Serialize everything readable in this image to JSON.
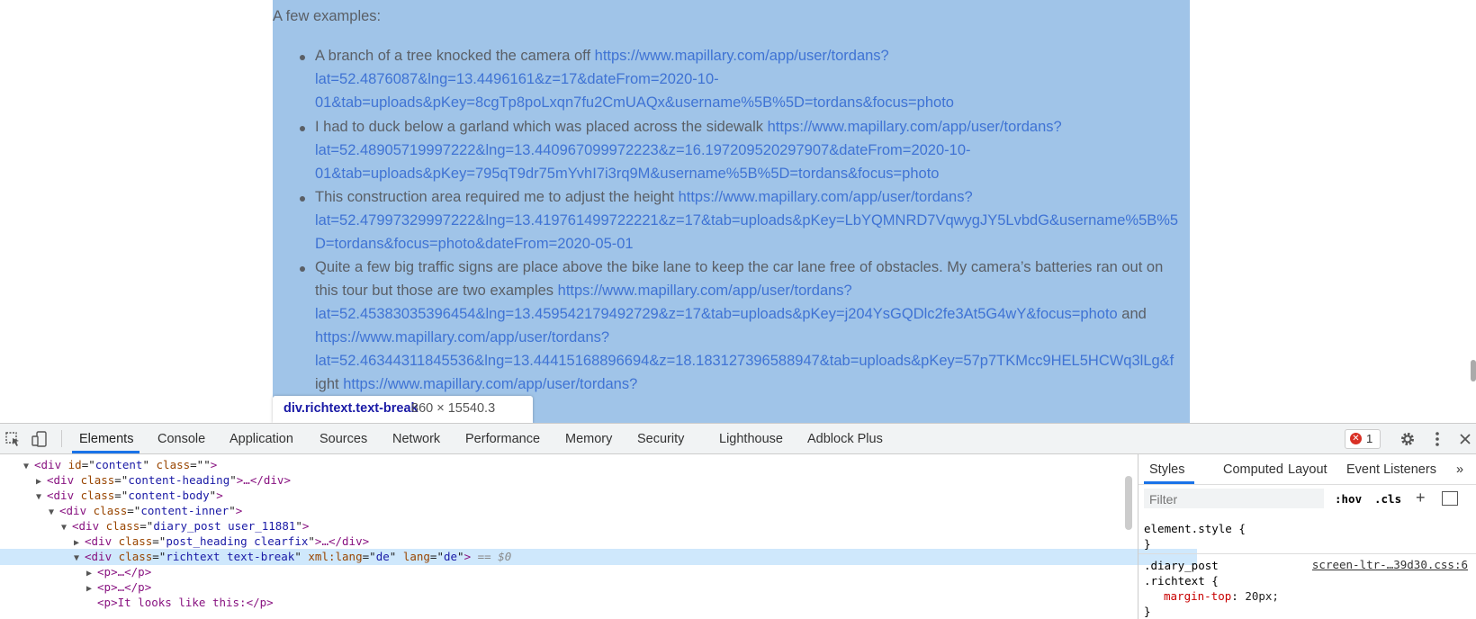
{
  "page": {
    "intro": "A few examples:",
    "bullets": [
      {
        "lines": [
          {
            "text": "A branch of a tree knocked the camera off ",
            "link": "https://www.mapillary.com/app/user/tordans?"
          },
          {
            "link": "lat=52.4876087&lng=13.4496161&z=17&dateFrom=2020-10-"
          },
          {
            "link": "01&tab=uploads&pKey=8cgTp8poLxqn7fu2CmUAQx&username%5B%5D=tordans&focus=photo"
          }
        ]
      },
      {
        "lines": [
          {
            "text": "I had to duck below a garland which was placed across the sidewalk ",
            "link": "https://www.mapillary.com/app/user/tordans?"
          },
          {
            "link": "lat=52.48905719997222&lng=13.440967099972223&z=16.197209520297907&dateFrom=2020-10-"
          },
          {
            "link": "01&tab=uploads&pKey=795qT9dr75mYvhI7i3rq9M&username%5B%5D=tordans&focus=photo"
          }
        ]
      },
      {
        "lines": [
          {
            "text": "This construction area required me to adjust the height ",
            "link": "https://www.mapillary.com/app/user/tordans?"
          },
          {
            "link": "lat=52.47997329997222&lng=13.419761499722221&z=17&tab=uploads&pKey=LbYQMNRD7VqwygJY5LvbdG&username%5B%5"
          },
          {
            "link": "D=tordans&focus=photo&dateFrom=2020-05-01"
          }
        ]
      },
      {
        "lines": [
          {
            "text": "Quite a few big traffic signs are place above the bike lane to keep the car lane free of obstacles. My camera’s batteries ran out on"
          },
          {
            "text": "this tour but those are two examples ",
            "link": "https://www.mapillary.com/app/user/tordans?"
          },
          {
            "link": "lat=52.45383035396454&lng=13.459542179492729&z=17&tab=uploads&pKey=j204YsGQDlc2fe3At5G4wY&focus=photo",
            "after": " and"
          },
          {
            "link": "https://www.mapillary.com/app/user/tordans?"
          },
          {
            "link": "lat=52.46344311845536&lng=13.44415168896694&z=18.183127396588947&tab=uploads&pKey=57p7TKMcc9HEL5HCWq3lLg&f"
          },
          {
            "text": "ight ",
            "link": "https://www.mapillary.com/app/user/tordans?"
          }
        ]
      }
    ]
  },
  "tooltip": {
    "selector": "div.richtext.text-break",
    "dims": "860 × 15540.3"
  },
  "devtools": {
    "tabs": [
      "Elements",
      "Console",
      "Application",
      "Sources",
      "Network",
      "Performance",
      "Memory",
      "Security",
      "Lighthouse",
      "Adblock Plus"
    ],
    "active_tab": "Elements",
    "error_count": "1",
    "dom_lines": [
      {
        "tag": "div",
        "attrs": [
          [
            "id",
            "content"
          ],
          [
            "class",
            ""
          ]
        ],
        "tail": ">",
        "triangle": "open",
        "indent": 0
      },
      {
        "tag": "div",
        "attrs": [
          [
            "class",
            "content-heading"
          ]
        ],
        "tail": ">…</div>",
        "triangle": "closed",
        "indent": 1
      },
      {
        "tag": "div",
        "attrs": [
          [
            "class",
            "content-body"
          ]
        ],
        "tail": ">",
        "triangle": "open",
        "indent": 1
      },
      {
        "tag": "div",
        "attrs": [
          [
            "class",
            "content-inner"
          ]
        ],
        "tail": ">",
        "triangle": "open",
        "indent": 2
      },
      {
        "tag": "div",
        "attrs": [
          [
            "class",
            "diary_post user_11881"
          ]
        ],
        "tail": ">",
        "triangle": "open",
        "indent": 3
      },
      {
        "tag": "div",
        "attrs": [
          [
            "class",
            "post_heading clearfix"
          ]
        ],
        "tail": ">…</div>",
        "triangle": "closed",
        "indent": 4
      },
      {
        "tag": "div",
        "attrs": [
          [
            "class",
            "richtext text-break"
          ],
          [
            "xml:lang",
            "de"
          ],
          [
            "lang",
            "de"
          ]
        ],
        "tail": ">",
        "suffix": " == $0",
        "triangle": "open",
        "indent": 4,
        "selected": true
      },
      {
        "tag": "p",
        "attrs": [],
        "tail": ">…</p>",
        "triangle": "closed",
        "indent": 5
      },
      {
        "tag": "p",
        "attrs": [],
        "tail": ">…</p>",
        "triangle": "closed",
        "indent": 5
      },
      {
        "tag": "p",
        "attrs": [],
        "tail": ">It looks like this:</p>",
        "triangle": "none",
        "indent": 5
      }
    ],
    "styles": {
      "tabs": [
        "Styles",
        "Computed",
        "Layout",
        "Event Listeners"
      ],
      "filter_placeholder": "Filter",
      "hov": ":hov",
      "cls": ".cls",
      "rules": [
        {
          "selector": "element.style {",
          "close": "}"
        },
        {
          "selector": ".diary_post",
          "selector2": ".richtext {",
          "source": "screen-ltr-…39d30.css:6",
          "prop": "margin-top",
          "value": "20px;",
          "close": "}"
        }
      ]
    }
  }
}
